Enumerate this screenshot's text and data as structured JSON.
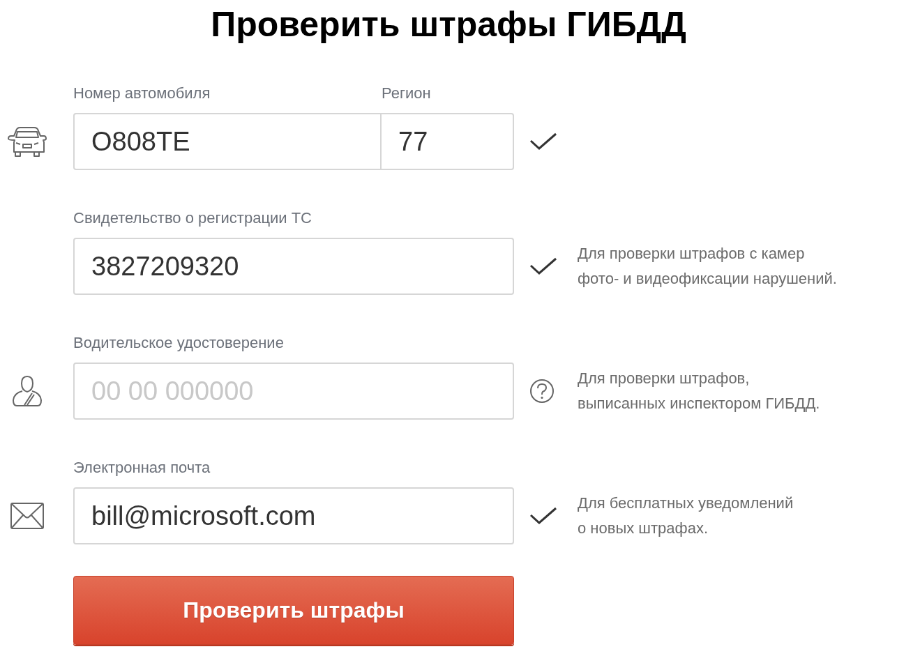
{
  "title": "Проверить штрафы ГИБДД",
  "fields": [
    {
      "kind": "plate",
      "valid": true,
      "inputs": [
        {
          "label": "Номер автомобиля",
          "value": "О808ТЕ"
        },
        {
          "label": "Регион",
          "value": "77"
        }
      ]
    },
    {
      "kind": "certificate",
      "valid": true,
      "inputs": [
        {
          "label": "Свидетельство о регистрации ТС",
          "value": "3827209320"
        }
      ],
      "hint": [
        "Для проверки штрафов с камер",
        "фото- и видеофиксации нарушений."
      ]
    },
    {
      "kind": "license",
      "valid": false,
      "inputs": [
        {
          "label": "Водительское удостоверение",
          "placeholder": "00 00 000000"
        }
      ],
      "hint": [
        "Для проверки штрафов,",
        "выписанных инспектором ГИБДД."
      ]
    },
    {
      "kind": "email",
      "valid": true,
      "inputs": [
        {
          "label": "Электронная почта",
          "value": "bill@microsoft.com"
        }
      ],
      "hint": [
        "Для бесплатных уведомлений",
        "о новых штрафах."
      ]
    }
  ],
  "button": "Проверить штрафы"
}
